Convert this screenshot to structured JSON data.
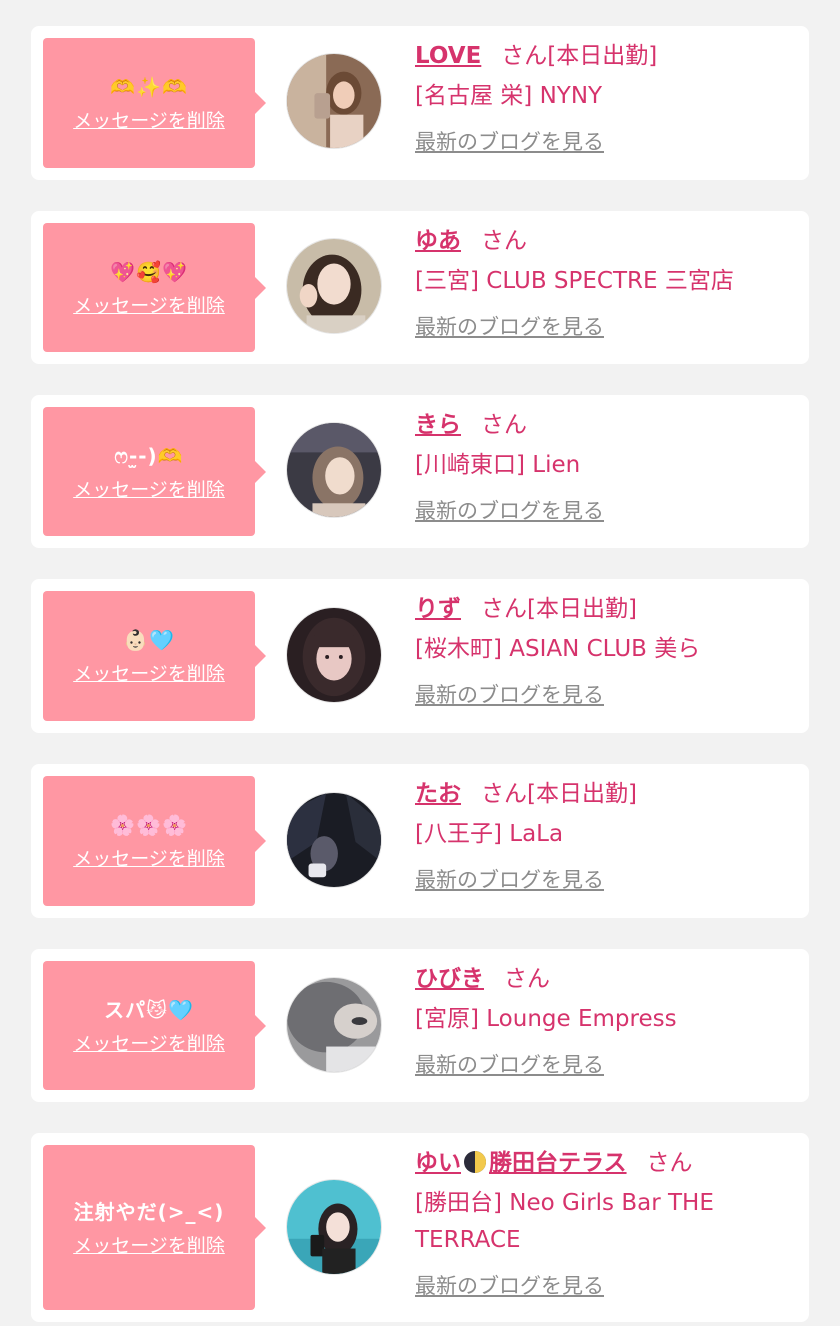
{
  "labels": {
    "delete_message": "メッセージを削除",
    "view_blog": "最新のブログを見る"
  },
  "colors": {
    "background": "#f2f2f2",
    "card": "#ffffff",
    "bubble": "#ff97a3",
    "name_pink": "#d6336c",
    "link_gray": "#8c8c8c"
  },
  "entries": [
    {
      "message": "🫶✨🫶",
      "name": "LOVE",
      "suffix": "さん[本日出勤]",
      "shop": "[名古屋 栄] NYNY",
      "avatar_icon": "profile-photo"
    },
    {
      "message": "💖🥰💖",
      "name": "ゆあ",
      "suffix": "さん",
      "shop": "[三宮] CLUB SPECTRE 三宮店",
      "avatar_icon": "profile-photo"
    },
    {
      "message": "ෆ‪‪-̫-)🫶",
      "name": "きら",
      "suffix": "さん",
      "shop": "[川崎東口] Lien",
      "avatar_icon": "profile-photo"
    },
    {
      "message": "👶🏻🩵",
      "name": "りず",
      "suffix": "さん[本日出勤]",
      "shop": "[桜木町] ASIAN CLUB 美ら",
      "avatar_icon": "profile-photo"
    },
    {
      "message": "🌸🌸🌸",
      "name": "たお",
      "suffix": "さん[本日出勤]",
      "shop": "[八王子] LaLa",
      "avatar_icon": "profile-photo"
    },
    {
      "message": "スパ😼🩵",
      "name": "ひびき",
      "suffix": "さん",
      "shop": "[宮原] Lounge Empress",
      "avatar_icon": "profile-photo"
    },
    {
      "message": "注射やだ(>_<)",
      "name_prefix": "ゆい",
      "name_emoji": "moon-icon",
      "name_rest": "勝田台テラス",
      "suffix": "さん",
      "shop": "[勝田台] Neo Girls Bar THE TERRACE",
      "avatar_icon": "profile-photo"
    }
  ]
}
